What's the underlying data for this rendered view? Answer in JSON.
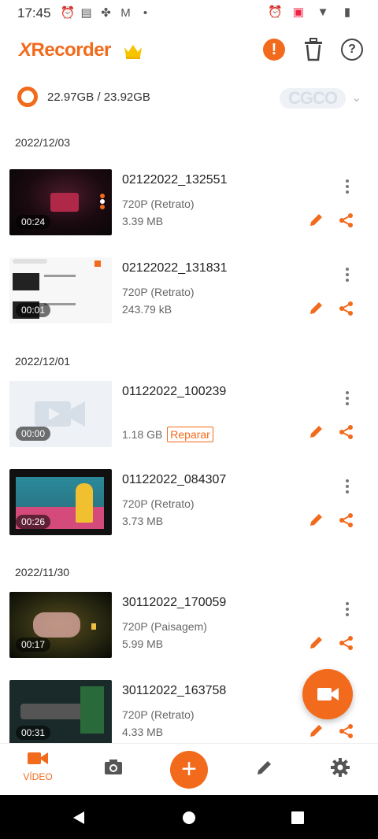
{
  "status_bar": {
    "time": "17:45"
  },
  "app_bar": {
    "logo_x": "X",
    "logo_rest": "Recorder",
    "help_label": "?",
    "alert_label": "!"
  },
  "storage": {
    "text": "22.97GB / 23.92GB",
    "promo": "CGCO"
  },
  "sections": [
    {
      "date": "2022/12/03"
    },
    {
      "date": "2022/12/01"
    },
    {
      "date": "2022/11/30"
    }
  ],
  "videos": [
    {
      "name": "02122022_132551",
      "resolution": "720P (Retrato)",
      "size": "3.39 MB",
      "duration": "00:24"
    },
    {
      "name": "02122022_131831",
      "resolution": "720P (Retrato)",
      "size": "243.79 kB",
      "duration": "00:01"
    },
    {
      "name": "01122022_100239",
      "resolution": "",
      "size": "1.18 GB",
      "repair": "Reparar",
      "duration": "00:00"
    },
    {
      "name": "01122022_084307",
      "resolution": "720P (Retrato)",
      "size": "3.73 MB",
      "duration": "00:26"
    },
    {
      "name": "30112022_170059",
      "resolution": "720P (Paisagem)",
      "size": "5.99 MB",
      "duration": "00:17"
    },
    {
      "name": "30112022_163758",
      "resolution": "720P (Retrato)",
      "size": "4.33 MB",
      "duration": "00:31"
    }
  ],
  "bottom_nav": {
    "video_label": "VÍDEO",
    "add_label": "+"
  },
  "colors": {
    "accent": "#f26a1b"
  }
}
